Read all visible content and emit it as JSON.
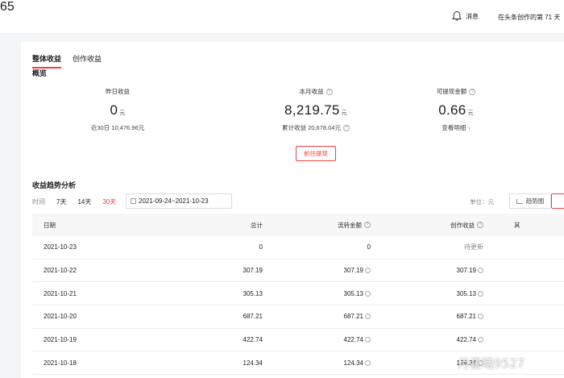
{
  "header": {
    "messages_label": "消息",
    "messages_badge": "65",
    "days_text": "在头条创作的第 71 天"
  },
  "tabs": [
    {
      "label": "整体收益",
      "active": true
    },
    {
      "label": "创作收益",
      "active": false
    }
  ],
  "overview": {
    "title": "概览",
    "yesterday": {
      "label": "昨日收益",
      "value": "0",
      "unit": "元",
      "sub": "近30日 10,476.96元"
    },
    "month": {
      "label": "本月收益",
      "value": "8,219.75",
      "unit": "元",
      "sub": "累计收益 20,678.04元"
    },
    "withdrawable": {
      "label": "可提现金额",
      "value": "0.66",
      "unit": "元",
      "sub": "查看明细"
    },
    "withdraw_button": "前往提现"
  },
  "trend": {
    "title": "收益趋势分析",
    "time_label": "时间",
    "options": [
      "7天",
      "14天",
      "30天"
    ],
    "active_option": "30天",
    "date_range": "2021-09-24~2021-10-23",
    "unit_label": "单位：元",
    "chart_button": "趋势图"
  },
  "table": {
    "headers": {
      "date": "日期",
      "total": "总计",
      "flow": "流转金额",
      "creation": "创作收益",
      "other": "其"
    },
    "rows": [
      {
        "date": "2021-10-23",
        "total": "0",
        "flow": "0",
        "creation": "待更新"
      },
      {
        "date": "2021-10-22",
        "total": "307.19",
        "flow": "307.19",
        "creation": "307.19"
      },
      {
        "date": "2021-10-21",
        "total": "305.13",
        "flow": "305.13",
        "creation": "305.13"
      },
      {
        "date": "2021-10-20",
        "total": "687.21",
        "flow": "687.21",
        "creation": "687.21"
      },
      {
        "date": "2021-10-19",
        "total": "422.74",
        "flow": "422.74",
        "creation": "422.74"
      },
      {
        "date": "2021-10-18",
        "total": "124.34",
        "flow": "124.34",
        "creation": "124.34"
      }
    ]
  },
  "watermark": "月星曦9527"
}
